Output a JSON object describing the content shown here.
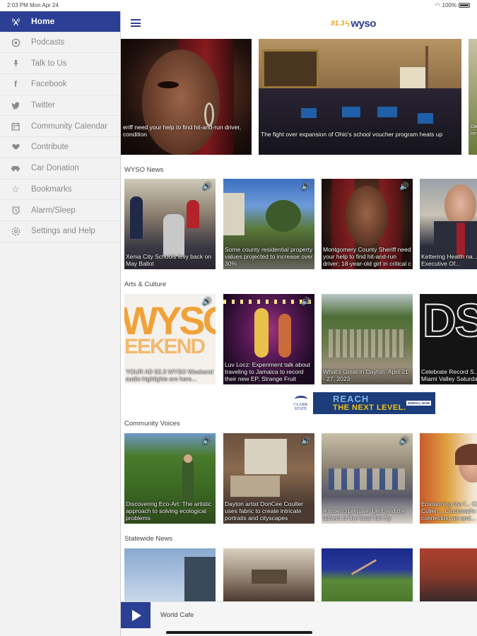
{
  "status_bar": {
    "time": "2:03 PM  Mon Apr 24",
    "battery": "100%"
  },
  "sidebar": {
    "items": [
      {
        "label": "Home",
        "icon": "radio-tower-icon",
        "active": true
      },
      {
        "label": "Podcasts",
        "icon": "podcast-icon"
      },
      {
        "label": "Talk to Us",
        "icon": "microphone-icon"
      },
      {
        "label": "Facebook",
        "icon": "facebook-icon"
      },
      {
        "label": "Twitter",
        "icon": "twitter-icon"
      },
      {
        "label": "Community Calendar",
        "icon": "calendar-icon"
      },
      {
        "label": "Contribute",
        "icon": "heart-hand-icon"
      },
      {
        "label": "Car Donation",
        "icon": "car-icon"
      },
      {
        "label": "Bookmarks",
        "icon": "star-icon"
      },
      {
        "label": "Alarm/Sleep",
        "icon": "alarm-clock-icon"
      },
      {
        "label": "Settings and Help",
        "icon": "gear-icon"
      }
    ]
  },
  "header": {
    "logo_number": "91.3",
    "logo_name": "wyso"
  },
  "hero": [
    {
      "caption": "eriff need your help to find hit-and-run driver, condition"
    },
    {
      "caption": "The fight over expansion of Ohio's school voucher program heats up"
    },
    {
      "caption": "Da... ren..."
    }
  ],
  "sections": [
    {
      "title": "WYSO News",
      "cards": [
        {
          "caption": "Xenia City Schools levy back on May Ballot",
          "audio": true
        },
        {
          "caption": "Some county residential property values projected to increase over 30%",
          "audio": true
        },
        {
          "caption": "Montgomery County Sheriff need your help to find hit-and-run driver; 18-year-old girl in critical c",
          "audio": true
        },
        {
          "caption": "Kettering Health na... Chief Executive Of...",
          "audio": false
        }
      ]
    },
    {
      "title": "Arts & Culture",
      "cards": [
        {
          "caption": "YOUR AD 92.3 WYSO Weekend audio highlights are here...",
          "audio": true
        },
        {
          "caption": "Luv Locz: Experiment talk about traveling to Jamaica to record their new EP, Strange Fruit",
          "audio": true
        },
        {
          "caption": "What's Great in Dayton: April 21 - 27, 2023",
          "audio": false
        },
        {
          "caption": "Celebrate Record S... in the Miami Valley Saturday",
          "audio": false
        }
      ]
    },
    {
      "title": "Community Voices",
      "cards": [
        {
          "caption": "Discovering Eco-Art: The artistic approach to solving ecological problems",
          "audio": true
        },
        {
          "caption": "Dayton artist DonCee Coulter uses fabric to create intricate portraits and cityscapes",
          "audio": true
        },
        {
          "caption": "A time to prepare: Lent and the advent of the local fish fry",
          "audio": true
        },
        {
          "caption": "Envisioning the f... Collagist Cullen... Cincinnati's Wave P... connecting art and...",
          "audio": false
        }
      ]
    },
    {
      "title": "Statewide News",
      "cards": [
        {
          "caption": "",
          "audio": false
        },
        {
          "caption": "",
          "audio": false
        },
        {
          "caption": "",
          "audio": false
        },
        {
          "caption": "",
          "audio": false
        }
      ]
    }
  ],
  "ad": {
    "sponsor_line1": "CLARK",
    "sponsor_line2": "STATE",
    "headline1": "REACH",
    "headline2": "THE NEXT LEVEL.",
    "cta": "ENROLL NOW"
  },
  "player": {
    "now_playing": "World Cafe"
  },
  "colors": {
    "brand_blue": "#2b3f94",
    "brand_orange": "#f3a21b"
  }
}
